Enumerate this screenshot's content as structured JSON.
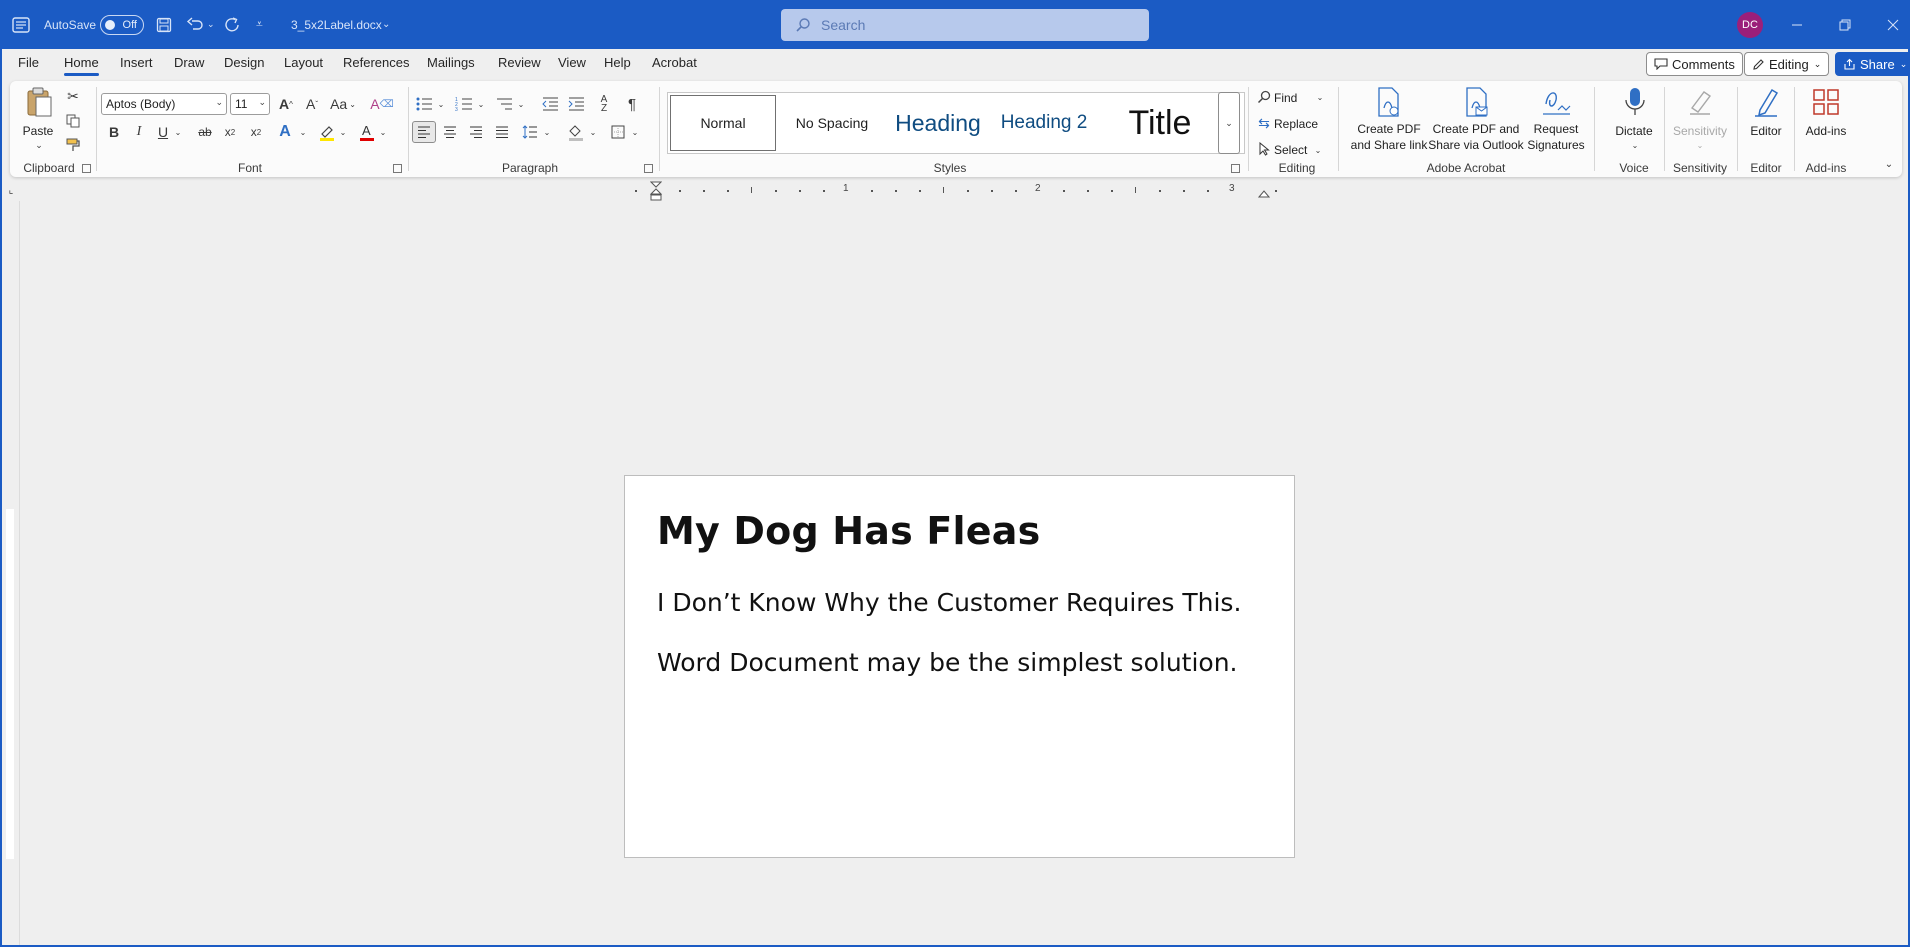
{
  "titlebar": {
    "autosave_label": "AutoSave",
    "autosave_state": "Off",
    "filename": "3_5x2Label.docx",
    "search_placeholder": "Search",
    "user_initials": "DC"
  },
  "menu": {
    "tabs": [
      "File",
      "Home",
      "Insert",
      "Draw",
      "Design",
      "Layout",
      "References",
      "Mailings",
      "Review",
      "View",
      "Help",
      "Acrobat"
    ],
    "active_tab": "Home",
    "comments_label": "Comments",
    "editing_label": "Editing",
    "share_label": "Share"
  },
  "ribbon": {
    "clipboard": {
      "paste_label": "Paste",
      "group_label": "Clipboard"
    },
    "font": {
      "font_name": "Aptos (Body)",
      "font_size": "11",
      "group_label": "Font"
    },
    "paragraph": {
      "group_label": "Paragraph"
    },
    "styles": {
      "items": [
        "Normal",
        "No Spacing",
        "Heading",
        "Heading 2",
        "Title"
      ],
      "selected": "Normal",
      "group_label": "Styles"
    },
    "editing": {
      "find_label": "Find",
      "replace_label": "Replace",
      "select_label": "Select",
      "group_label": "Editing"
    },
    "acrobat": {
      "create_pdf_share_link_line1": "Create PDF",
      "create_pdf_share_link_line2": "and Share link",
      "create_pdf_outlook_line1": "Create PDF and",
      "create_pdf_outlook_line2": "Share via Outlook",
      "request_signatures_line1": "Request",
      "request_signatures_line2": "Signatures",
      "group_label": "Adobe Acrobat"
    },
    "voice": {
      "dictate_label": "Dictate",
      "group_label": "Voice"
    },
    "sensitivity": {
      "button_label": "Sensitivity",
      "group_label": "Sensitivity"
    },
    "editor": {
      "button_label": "Editor",
      "group_label": "Editor"
    },
    "addins": {
      "button_label": "Add-ins",
      "group_label": "Add-ins"
    }
  },
  "ruler": {
    "numbers": [
      "1",
      "2",
      "3"
    ]
  },
  "document": {
    "title": "My Dog Has Fleas",
    "paragraphs": [
      "I Don’t Know Why the Customer Requires This.",
      "Word Document may be the simplest solution."
    ]
  },
  "colors": {
    "titlebar": "#1b5bc4",
    "avatar": "#9b1f7a",
    "accent": "#1b5bc4"
  }
}
